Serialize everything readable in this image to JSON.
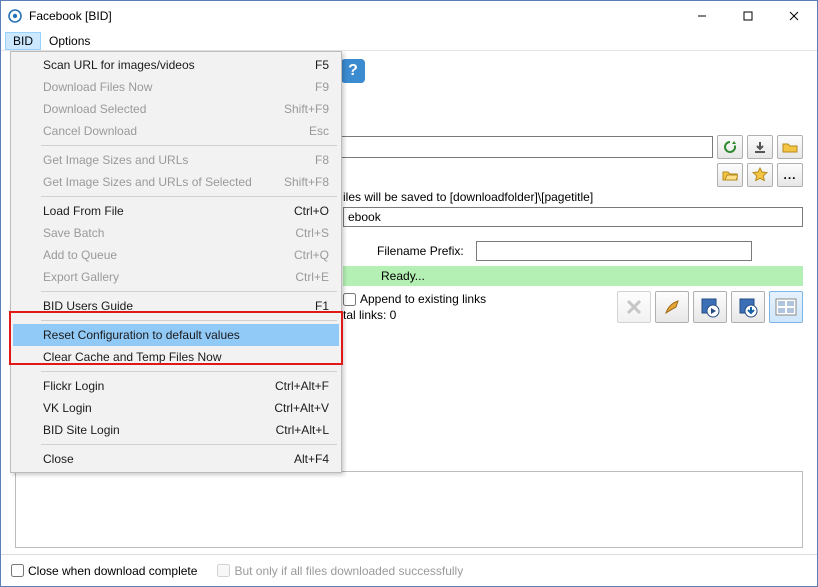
{
  "window": {
    "title": "Facebook [BID]"
  },
  "menubar": {
    "bid": "BID",
    "options": "Options"
  },
  "menu": {
    "scan_url": {
      "label": "Scan URL for images/videos",
      "shortcut": "F5",
      "enabled": true
    },
    "download_now": {
      "label": "Download Files Now",
      "shortcut": "F9",
      "enabled": false
    },
    "download_selected": {
      "label": "Download Selected",
      "shortcut": "Shift+F9",
      "enabled": false
    },
    "cancel_download": {
      "label": "Cancel Download",
      "shortcut": "Esc",
      "enabled": false
    },
    "get_sizes": {
      "label": "Get Image Sizes and URLs",
      "shortcut": "F8",
      "enabled": false
    },
    "get_sizes_selected": {
      "label": "Get Image Sizes and URLs of Selected",
      "shortcut": "Shift+F8",
      "enabled": false
    },
    "load_from_file": {
      "label": "Load From File",
      "shortcut": "Ctrl+O",
      "enabled": true
    },
    "save_batch": {
      "label": "Save Batch",
      "shortcut": "Ctrl+S",
      "enabled": false
    },
    "add_to_queue": {
      "label": "Add to Queue",
      "shortcut": "Ctrl+Q",
      "enabled": false
    },
    "export_gallery": {
      "label": "Export Gallery",
      "shortcut": "Ctrl+E",
      "enabled": false
    },
    "users_guide": {
      "label": "BID Users Guide",
      "shortcut": "F1",
      "enabled": true
    },
    "reset_config": {
      "label": "Reset Configuration to default values",
      "shortcut": "",
      "enabled": true
    },
    "clear_cache": {
      "label": "Clear Cache and Temp Files Now",
      "shortcut": "",
      "enabled": true
    },
    "flickr_login": {
      "label": "Flickr Login",
      "shortcut": "Ctrl+Alt+F",
      "enabled": true
    },
    "vk_login": {
      "label": "VK Login",
      "shortcut": "Ctrl+Alt+V",
      "enabled": true
    },
    "bid_site_login": {
      "label": "BID Site Login",
      "shortcut": "Ctrl+Alt+L",
      "enabled": true
    },
    "close": {
      "label": "Close",
      "shortcut": "Alt+F4",
      "enabled": true
    }
  },
  "main": {
    "save_hint": "iles will be saved to [downloadfolder]\\[pagetitle]",
    "path_value": "ebook",
    "filename_prefix_label": "Filename Prefix:",
    "status": "Ready...",
    "append_label": "Append to existing links",
    "total_links": "tal links: 0"
  },
  "footer": {
    "close_when_done": "Close when download complete",
    "only_if_success": "But only if all files downloaded successfully"
  },
  "icons": {
    "reload": "reload-icon",
    "down": "download-icon",
    "folder": "folder-icon",
    "open": "open-icon",
    "star": "favorite-icon",
    "more": "more-icon",
    "delete": "delete-icon",
    "brush": "brush-icon",
    "disk_play": "disk-play-icon",
    "disk_down": "disk-down-icon",
    "thumbs": "thumbnails-icon"
  }
}
